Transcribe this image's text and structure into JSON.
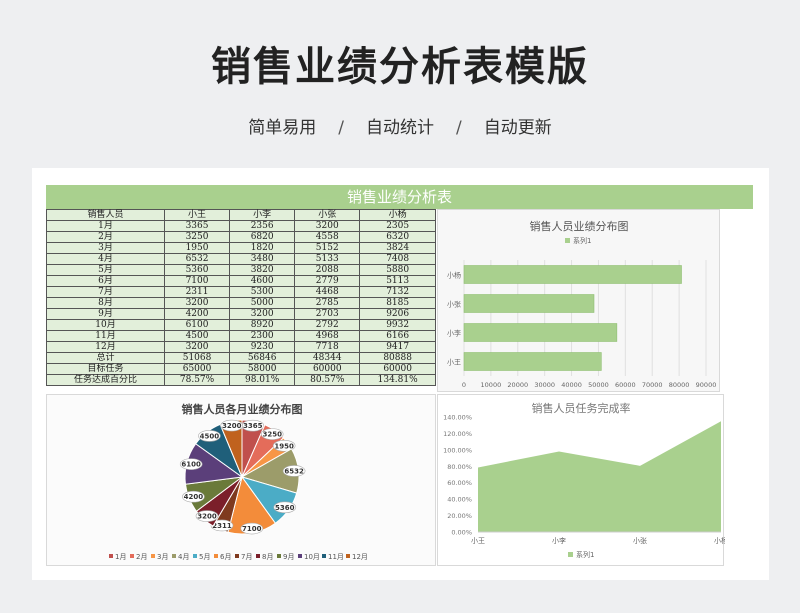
{
  "hero": {
    "title": "销售业绩分析表模版",
    "tags": [
      "简单易用",
      "自动统计",
      "自动更新"
    ],
    "separator": "/"
  },
  "sheet": {
    "title": "销售业绩分析表",
    "headers": [
      "销售人员",
      "小王",
      "小李",
      "小张",
      "小杨"
    ],
    "rows": [
      [
        "1月",
        "3365",
        "2356",
        "3200",
        "2305"
      ],
      [
        "2月",
        "3250",
        "6820",
        "4558",
        "6320"
      ],
      [
        "3月",
        "1950",
        "1820",
        "5152",
        "3824"
      ],
      [
        "4月",
        "6532",
        "3480",
        "5133",
        "7408"
      ],
      [
        "5月",
        "5360",
        "3820",
        "2088",
        "5880"
      ],
      [
        "6月",
        "7100",
        "4600",
        "2779",
        "5113"
      ],
      [
        "7月",
        "2311",
        "5300",
        "4468",
        "7132"
      ],
      [
        "8月",
        "3200",
        "5000",
        "2785",
        "8185"
      ],
      [
        "9月",
        "4200",
        "3200",
        "2703",
        "9206"
      ],
      [
        "10月",
        "6100",
        "8920",
        "2792",
        "9932"
      ],
      [
        "11月",
        "4500",
        "2300",
        "4968",
        "6166"
      ],
      [
        "12月",
        "3200",
        "9230",
        "7718",
        "9417"
      ],
      [
        "总计",
        "51068",
        "56846",
        "48344",
        "80888"
      ],
      [
        "目标任务",
        "65000",
        "58000",
        "60000",
        "60000"
      ],
      [
        "任务达成百分比",
        "78.57%",
        "98.01%",
        "80.57%",
        "134.81%"
      ]
    ]
  },
  "chart_data": [
    {
      "type": "bar",
      "orientation": "horizontal",
      "title": "销售人员业绩分布图",
      "legend": "系列1",
      "legend_position": "top",
      "categories": [
        "小王",
        "小李",
        "小张",
        "小杨"
      ],
      "values": [
        51068,
        56846,
        48344,
        80888
      ],
      "xlim": [
        0,
        90000
      ],
      "ticks": [
        "0",
        "10000",
        "20000",
        "30000",
        "40000",
        "50000",
        "60000",
        "70000",
        "80000",
        "90000"
      ],
      "grid": true,
      "color": "#a9d08e"
    },
    {
      "type": "pie",
      "title": "销售人员各月业绩分布图",
      "legend_position": "bottom",
      "categories": [
        "1月",
        "2月",
        "3月",
        "4月",
        "5月",
        "6月",
        "7月",
        "8月",
        "9月",
        "10月",
        "11月",
        "12月"
      ],
      "values": [
        3365,
        3250,
        1950,
        6532,
        5360,
        7100,
        2311,
        3200,
        4200,
        6100,
        4500,
        3200
      ],
      "colors": [
        "#c0504d",
        "#e46c5a",
        "#f79646",
        "#9c9c6a",
        "#4bacc6",
        "#f38c3a",
        "#7f3a1e",
        "#7b1f2a",
        "#6a7a3a",
        "#5b3f7a",
        "#1f5f7a",
        "#c0621e"
      ]
    },
    {
      "type": "area",
      "title": "销售人员任务完成率",
      "legend": "系列1",
      "legend_position": "bottom",
      "categories": [
        "小王",
        "小李",
        "小张",
        "小杨"
      ],
      "values": [
        78.57,
        98.01,
        80.57,
        134.81
      ],
      "ylim": [
        0,
        140
      ],
      "ticks": [
        "0.00%",
        "20.00%",
        "40.00%",
        "60.00%",
        "80.00%",
        "100.00%",
        "120.00%",
        "140.00%"
      ],
      "color": "#a9d08e"
    }
  ]
}
